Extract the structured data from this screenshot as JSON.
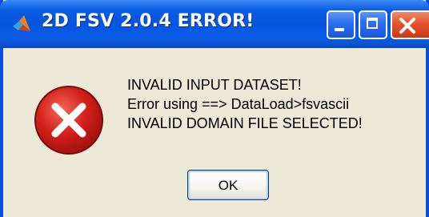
{
  "window": {
    "title": "2D FSV 2.0.4 ERROR!",
    "app_icon": "matlab-logo-icon",
    "controls": {
      "minimize_icon": "minimize-icon",
      "maximize_icon": "maximize-icon",
      "close_icon": "close-icon"
    }
  },
  "dialog": {
    "icon": "error-icon",
    "message_lines": [
      "INVALID INPUT DATASET!",
      "Error using ==> DataLoad>fsvascii",
      "INVALID DOMAIN FILE SELECTED!"
    ],
    "ok_label": "OK"
  },
  "colors": {
    "titlebar": "#0656e0",
    "dialog_background": "#ece9d8",
    "close_button": "#e3542c",
    "error_icon": "#d4201b"
  }
}
